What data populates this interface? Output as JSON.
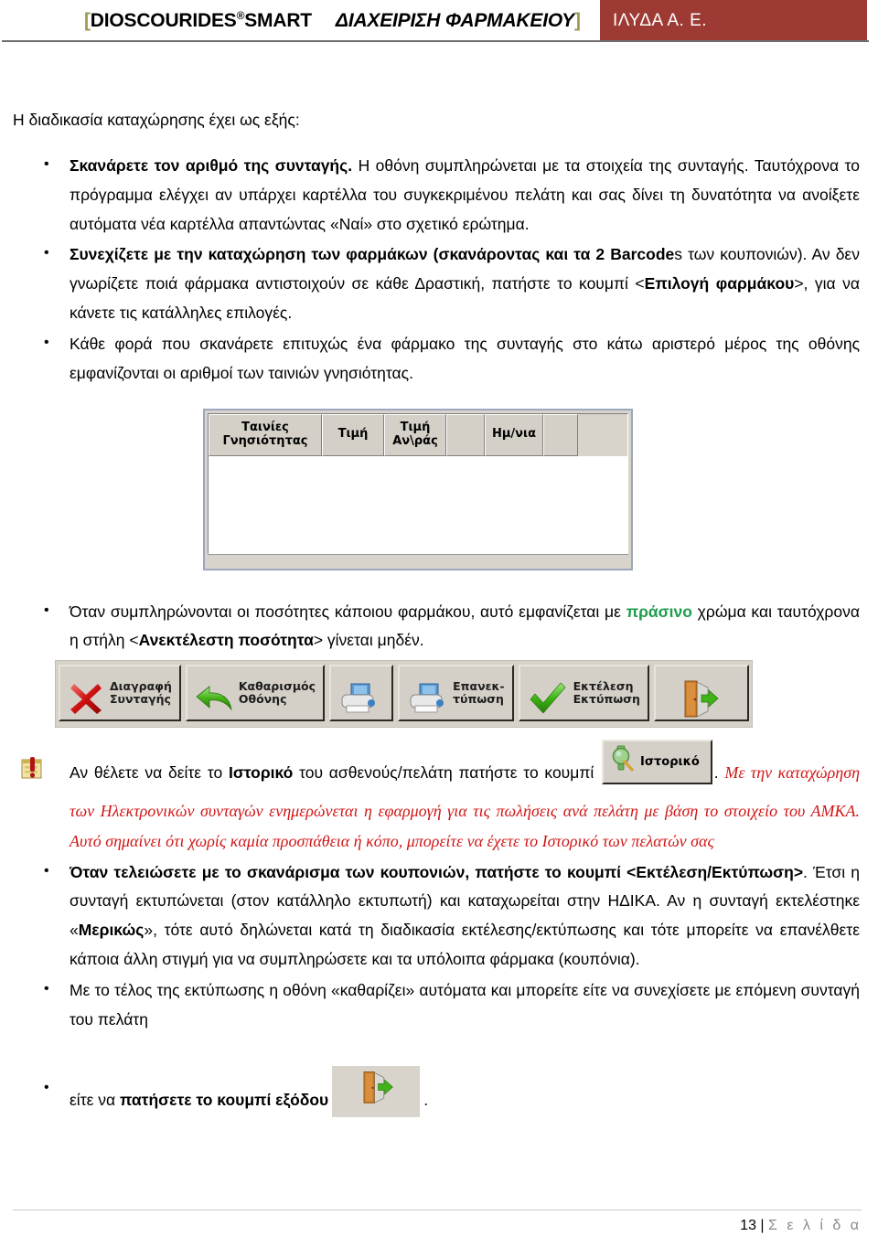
{
  "header": {
    "bracket_open": "[",
    "brand": "DIOSCOURIDES",
    "registered_mark": "®",
    "brand_suffix": "SMART",
    "subtitle": "ΔΙΑΧΕΙΡΙΣΗ ΦΑΡΜΑΚΕΙΟΥ",
    "bracket_close": "]",
    "company": "ΙΛΥΔΑ  Α. Ε.",
    "company_bg": "#9e3a34",
    "bracket_color": "#9b9b53"
  },
  "body": {
    "intro": "Η διαδικασία καταχώρησης έχει ως εξής:",
    "bullet1_bold": "Σκανάρετε τον αριθμό της συνταγής.",
    "bullet1_rest": " Η οθόνη συμπληρώνεται με τα στοιχεία της συνταγής. Ταυτόχρονα το πρόγραμμα ελέγχει αν υπάρχει καρτέλλα του συγκεκριμένου πελάτη και σας δίνει τη δυνατότητα να ανοίξετε αυτόματα νέα καρτέλλα απαντώντας «Ναί» στο σχετικό ερώτημα.",
    "bullet2_bold": "Συνεχίζετε με την καταχώρηση των φαρμάκων (σκανάροντας και τα 2 Barcode",
    "bullet2_mid": "s των κουπονιών). Αν δεν γνωρίζετε ποιά φάρμακα αντιστοιχούν σε κάθε Δραστική, πατήστε το κουμπί <",
    "bullet2_bold2": "Επιλογή φαρμάκου",
    "bullet2_end": ">, για να κάνετε τις κατάλληλες επιλογές.",
    "bullet3": "Κάθε φορά που σκανάρετε επιτυχώς ένα φάρμακο της συνταγής στο κάτω αριστερό μέρος της οθόνης εμφανίζονται οι αριθμοί των ταινιών γνησιότητας.",
    "bullet4_pre": "Όταν συμπληρώνονται οι ποσότητες κάποιου φαρμάκου, αυτό εμφανίζεται με ",
    "bullet4_green": "πράσινο",
    "bullet4_mid": " χρώμα και ταυτόχρονα η στήλη <",
    "bullet4_bold": "Ανεκτέλεστη ποσότητα",
    "bullet4_end": "> γίνεται μηδέν.",
    "green_color": "#1f9d4f",
    "history_pre": "Αν θέλετε να δείτε το ",
    "history_bold": "Ιστορικό",
    "history_mid": " του ασθενούς/πελάτη πατήστε το κουμπί ",
    "history_after": ". ",
    "history_red": "Με την καταχώρηση των Ηλεκτρονικών συνταγών ενημερώνεται η εφαρμογή για τις πωλήσεις ανά πελάτη με βάση το στοιχείο του ΑΜΚΑ. Αυτό σημαίνει ότι χωρίς καμία προσπάθεια ή κόπο, μπορείτε να έχετε το Ιστορικό των πελατών σας",
    "red_color": "#d01616",
    "bullet5_bold": "Όταν τελειώσετε με το σκανάρισμα των κουπονιών, πατήστε το κουμπί <Εκτέλεση/Εκτύπωση>",
    "bullet5_mid": ". Έτσι η συνταγή εκτυπώνεται (στον κατάλληλο εκτυπωτή) και καταχωρείται  στην ΗΔΙΚΑ. Αν η συνταγή εκτελέστηκε «",
    "bullet5_bold2": "Μερικώς",
    "bullet5_end": "», τότε αυτό δηλώνεται κατά τη διαδικασία εκτέλεσης/εκτύπωσης και τότε μπορείτε να επανέλθετε κάποια άλλη στιγμή για να συμπληρώσετε και τα υπόλοιπα φάρμακα (κουπόνια).",
    "bullet6": "Με το τέλος της εκτύπωσης η οθόνη «καθαρίζει» αυτόματα και μπορείτε είτε να συνεχίσετε με επόμενη συνταγή του πελάτη",
    "bullet7_pre": "είτε να ",
    "bullet7_bold": "πατήσετε το κουμπί εξόδου",
    "bullet7_end": "."
  },
  "grid_widget": {
    "columns": [
      "Ταινίες\nΓνησιότητας",
      "Τιμή",
      "Τιμή\nΑν\\ράς",
      "",
      "Ημ/νια",
      ""
    ],
    "rows": []
  },
  "toolbar": {
    "buttons": [
      {
        "icon": "red-x-icon",
        "label": "Διαγραφή\nΣυνταγής"
      },
      {
        "icon": "green-undo-arrow-icon",
        "label": "Καθαρισμός\nΟθόνης"
      },
      {
        "icon": "printer-icon",
        "label": ""
      },
      {
        "icon": "printer-icon",
        "label": "Επανεκ-\nτύπωση"
      },
      {
        "icon": "green-check-icon",
        "label": "Εκτέλεση\nΕκτύπωση"
      },
      {
        "icon": "exit-door-icon",
        "label": ""
      }
    ]
  },
  "history_button": {
    "icon": "magnifier-icon",
    "label": "Ιστορικό"
  },
  "exit_button": {
    "icon": "exit-door-icon"
  },
  "footer": {
    "page_number": "13",
    "separator": "|",
    "label": "Σ ε λ ί δ α"
  }
}
